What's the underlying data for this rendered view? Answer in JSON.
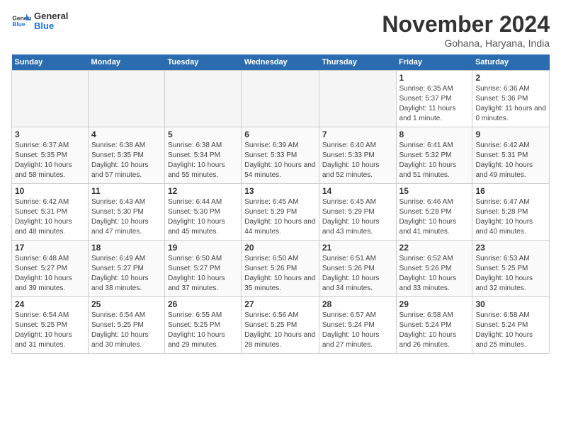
{
  "logo": {
    "text_general": "General",
    "text_blue": "Blue"
  },
  "header": {
    "month": "November 2024",
    "location": "Gohana, Haryana, India"
  },
  "days_of_week": [
    "Sunday",
    "Monday",
    "Tuesday",
    "Wednesday",
    "Thursday",
    "Friday",
    "Saturday"
  ],
  "weeks": [
    [
      {
        "day": "",
        "empty": true
      },
      {
        "day": "",
        "empty": true
      },
      {
        "day": "",
        "empty": true
      },
      {
        "day": "",
        "empty": true
      },
      {
        "day": "",
        "empty": true
      },
      {
        "day": "1",
        "sunrise": "Sunrise: 6:35 AM",
        "sunset": "Sunset: 5:37 PM",
        "daylight": "Daylight: 11 hours and 1 minute."
      },
      {
        "day": "2",
        "sunrise": "Sunrise: 6:36 AM",
        "sunset": "Sunset: 5:36 PM",
        "daylight": "Daylight: 11 hours and 0 minutes."
      }
    ],
    [
      {
        "day": "3",
        "sunrise": "Sunrise: 6:37 AM",
        "sunset": "Sunset: 5:35 PM",
        "daylight": "Daylight: 10 hours and 58 minutes."
      },
      {
        "day": "4",
        "sunrise": "Sunrise: 6:38 AM",
        "sunset": "Sunset: 5:35 PM",
        "daylight": "Daylight: 10 hours and 57 minutes."
      },
      {
        "day": "5",
        "sunrise": "Sunrise: 6:38 AM",
        "sunset": "Sunset: 5:34 PM",
        "daylight": "Daylight: 10 hours and 55 minutes."
      },
      {
        "day": "6",
        "sunrise": "Sunrise: 6:39 AM",
        "sunset": "Sunset: 5:33 PM",
        "daylight": "Daylight: 10 hours and 54 minutes."
      },
      {
        "day": "7",
        "sunrise": "Sunrise: 6:40 AM",
        "sunset": "Sunset: 5:33 PM",
        "daylight": "Daylight: 10 hours and 52 minutes."
      },
      {
        "day": "8",
        "sunrise": "Sunrise: 6:41 AM",
        "sunset": "Sunset: 5:32 PM",
        "daylight": "Daylight: 10 hours and 51 minutes."
      },
      {
        "day": "9",
        "sunrise": "Sunrise: 6:42 AM",
        "sunset": "Sunset: 5:31 PM",
        "daylight": "Daylight: 10 hours and 49 minutes."
      }
    ],
    [
      {
        "day": "10",
        "sunrise": "Sunrise: 6:42 AM",
        "sunset": "Sunset: 5:31 PM",
        "daylight": "Daylight: 10 hours and 48 minutes."
      },
      {
        "day": "11",
        "sunrise": "Sunrise: 6:43 AM",
        "sunset": "Sunset: 5:30 PM",
        "daylight": "Daylight: 10 hours and 47 minutes."
      },
      {
        "day": "12",
        "sunrise": "Sunrise: 6:44 AM",
        "sunset": "Sunset: 5:30 PM",
        "daylight": "Daylight: 10 hours and 45 minutes."
      },
      {
        "day": "13",
        "sunrise": "Sunrise: 6:45 AM",
        "sunset": "Sunset: 5:29 PM",
        "daylight": "Daylight: 10 hours and 44 minutes."
      },
      {
        "day": "14",
        "sunrise": "Sunrise: 6:45 AM",
        "sunset": "Sunset: 5:29 PM",
        "daylight": "Daylight: 10 hours and 43 minutes."
      },
      {
        "day": "15",
        "sunrise": "Sunrise: 6:46 AM",
        "sunset": "Sunset: 5:28 PM",
        "daylight": "Daylight: 10 hours and 41 minutes."
      },
      {
        "day": "16",
        "sunrise": "Sunrise: 6:47 AM",
        "sunset": "Sunset: 5:28 PM",
        "daylight": "Daylight: 10 hours and 40 minutes."
      }
    ],
    [
      {
        "day": "17",
        "sunrise": "Sunrise: 6:48 AM",
        "sunset": "Sunset: 5:27 PM",
        "daylight": "Daylight: 10 hours and 39 minutes."
      },
      {
        "day": "18",
        "sunrise": "Sunrise: 6:49 AM",
        "sunset": "Sunset: 5:27 PM",
        "daylight": "Daylight: 10 hours and 38 minutes."
      },
      {
        "day": "19",
        "sunrise": "Sunrise: 6:50 AM",
        "sunset": "Sunset: 5:27 PM",
        "daylight": "Daylight: 10 hours and 37 minutes."
      },
      {
        "day": "20",
        "sunrise": "Sunrise: 6:50 AM",
        "sunset": "Sunset: 5:26 PM",
        "daylight": "Daylight: 10 hours and 35 minutes."
      },
      {
        "day": "21",
        "sunrise": "Sunrise: 6:51 AM",
        "sunset": "Sunset: 5:26 PM",
        "daylight": "Daylight: 10 hours and 34 minutes."
      },
      {
        "day": "22",
        "sunrise": "Sunrise: 6:52 AM",
        "sunset": "Sunset: 5:26 PM",
        "daylight": "Daylight: 10 hours and 33 minutes."
      },
      {
        "day": "23",
        "sunrise": "Sunrise: 6:53 AM",
        "sunset": "Sunset: 5:25 PM",
        "daylight": "Daylight: 10 hours and 32 minutes."
      }
    ],
    [
      {
        "day": "24",
        "sunrise": "Sunrise: 6:54 AM",
        "sunset": "Sunset: 5:25 PM",
        "daylight": "Daylight: 10 hours and 31 minutes."
      },
      {
        "day": "25",
        "sunrise": "Sunrise: 6:54 AM",
        "sunset": "Sunset: 5:25 PM",
        "daylight": "Daylight: 10 hours and 30 minutes."
      },
      {
        "day": "26",
        "sunrise": "Sunrise: 6:55 AM",
        "sunset": "Sunset: 5:25 PM",
        "daylight": "Daylight: 10 hours and 29 minutes."
      },
      {
        "day": "27",
        "sunrise": "Sunrise: 6:56 AM",
        "sunset": "Sunset: 5:25 PM",
        "daylight": "Daylight: 10 hours and 28 minutes."
      },
      {
        "day": "28",
        "sunrise": "Sunrise: 6:57 AM",
        "sunset": "Sunset: 5:24 PM",
        "daylight": "Daylight: 10 hours and 27 minutes."
      },
      {
        "day": "29",
        "sunrise": "Sunrise: 6:58 AM",
        "sunset": "Sunset: 5:24 PM",
        "daylight": "Daylight: 10 hours and 26 minutes."
      },
      {
        "day": "30",
        "sunrise": "Sunrise: 6:58 AM",
        "sunset": "Sunset: 5:24 PM",
        "daylight": "Daylight: 10 hours and 25 minutes."
      }
    ]
  ]
}
